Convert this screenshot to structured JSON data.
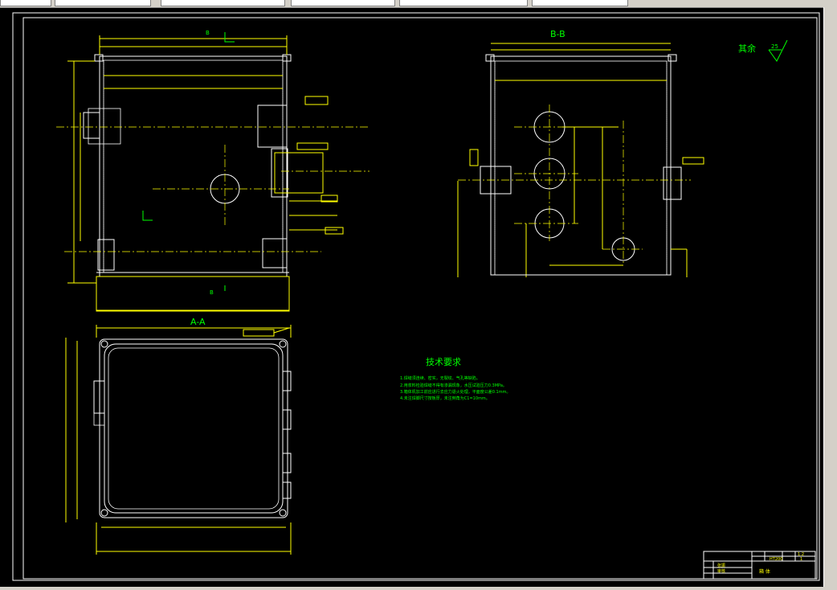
{
  "toolbar": {
    "field1": "",
    "field2": "",
    "field3": "",
    "field4": "",
    "field5": "",
    "field6": ""
  },
  "drawing": {
    "top_view_cut_label": "B",
    "section_aa_title": "A-A",
    "section_bb_title": "B-B",
    "roughness_note": "其余",
    "roughness_value": "25",
    "tech_title": "技术要求",
    "tech_notes": [
      "1.焊缝须连续、密实，无裂纹、气孔等缺陷。",
      "2.用浆料检验焊缝不得有渗漏现象，水压试验压力0.3MPa。",
      "3.箱体机加工前应进行去应力退火处理，平面度公差0.1mm。",
      "4.未注焊脚尺寸按板厚，未注倒角为C1=10mm。"
    ],
    "title_block": {
      "part_name": "箱 体",
      "scale": "1:2",
      "material": "HT200",
      "quantity": "1",
      "designer": "张振",
      "checker": "审核"
    }
  },
  "colors": {
    "background": "#000000",
    "geometry": "#ffffff",
    "dimensions": "#ffff00",
    "annotations": "#00ff00",
    "ui_chrome": "#d4d0c8"
  }
}
